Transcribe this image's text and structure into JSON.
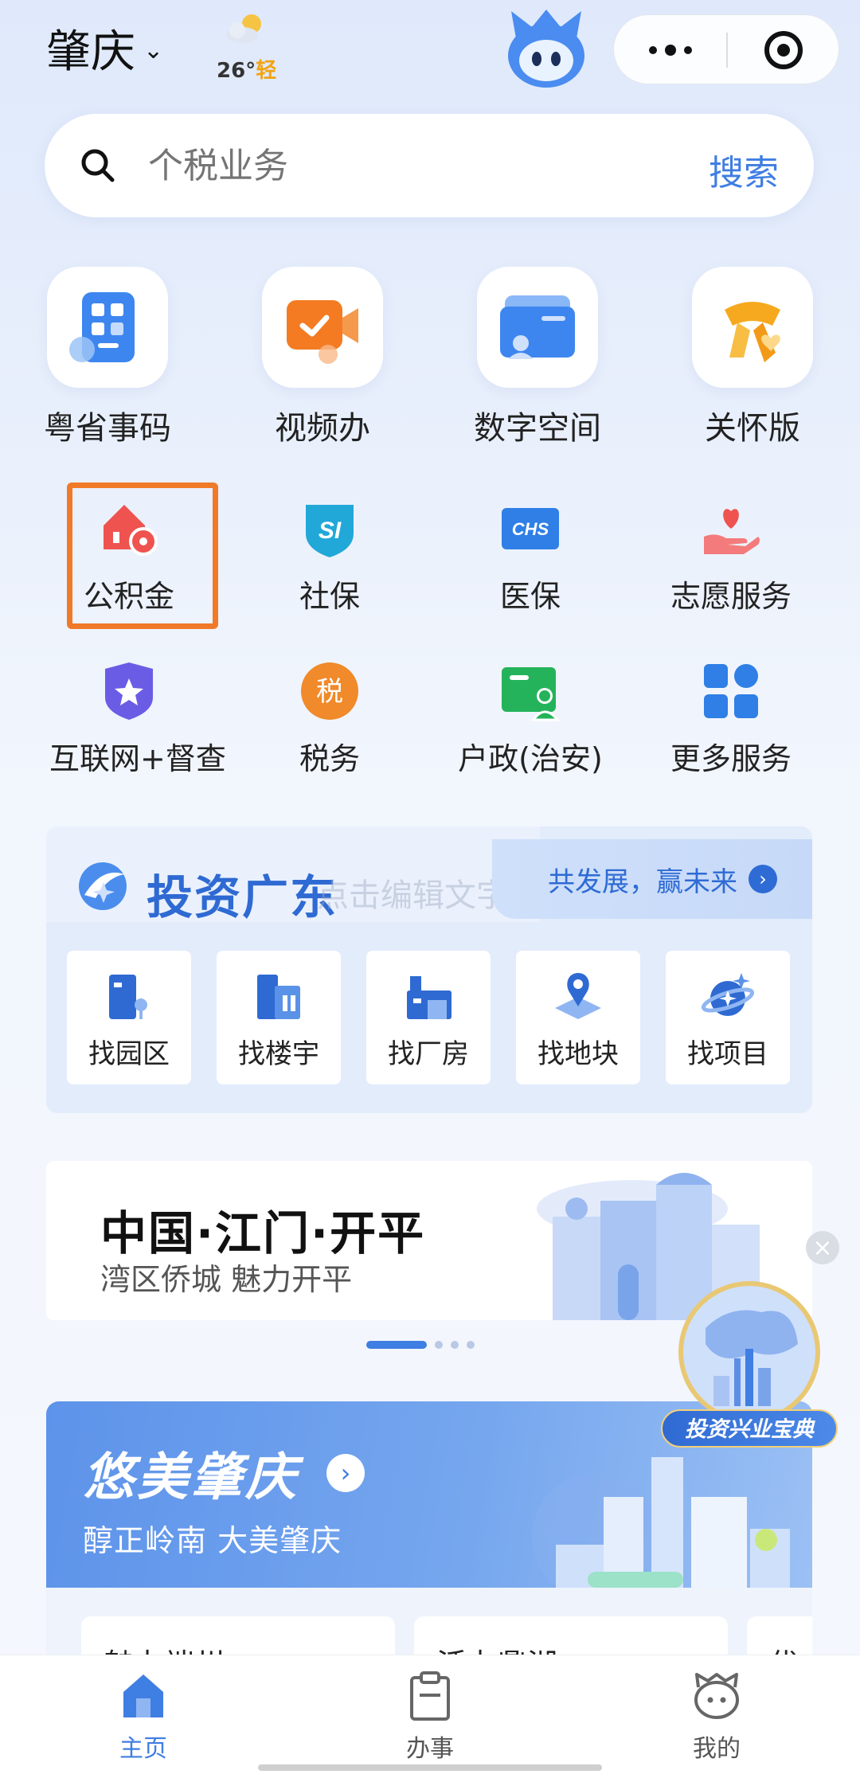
{
  "header": {
    "city": "肇庆",
    "weather_temp": "26°",
    "weather_quality": "轻"
  },
  "search": {
    "placeholder": "个税业务",
    "button": "搜索"
  },
  "quick": [
    {
      "label": "粤省事码",
      "icon": "qr-code-icon"
    },
    {
      "label": "视频办",
      "icon": "video-camera-icon"
    },
    {
      "label": "数字空间",
      "icon": "folder-user-icon"
    },
    {
      "label": "关怀版",
      "icon": "scarf-heart-icon"
    }
  ],
  "services": [
    {
      "label": "公积金",
      "icon": "house-fund-icon"
    },
    {
      "label": "社保",
      "icon": "social-security-icon"
    },
    {
      "label": "医保",
      "icon": "medical-insurance-icon"
    },
    {
      "label": "志愿服务",
      "icon": "heart-hand-icon"
    },
    {
      "label": "互联网+督查",
      "icon": "star-shield-icon"
    },
    {
      "label": "税务",
      "icon": "tax-icon"
    },
    {
      "label": "户政(治安)",
      "icon": "id-card-icon"
    },
    {
      "label": "更多服务",
      "icon": "grid-icon"
    }
  ],
  "service_icon_text": {
    "social": "SI",
    "medical": "CHS",
    "tax": "税"
  },
  "invest": {
    "title": "投资广东",
    "ghost_text": "点击编辑文字",
    "slogan": "共发展，赢未来",
    "items": [
      {
        "label": "找园区",
        "icon": "park-building-icon"
      },
      {
        "label": "找楼宇",
        "icon": "office-building-icon"
      },
      {
        "label": "找厂房",
        "icon": "factory-icon"
      },
      {
        "label": "找地块",
        "icon": "land-pin-icon"
      },
      {
        "label": "找项目",
        "icon": "project-planet-icon"
      }
    ]
  },
  "banner": {
    "title": "中国·江门·开平",
    "subtitle": "湾区侨城 魅力开平"
  },
  "float_badge": {
    "label": "投资兴业宝典"
  },
  "youmei": {
    "title": "悠美肇庆",
    "subtitle": "醇正岭南 大美肇庆",
    "sub_cards": [
      "魅力端州",
      "活力鼎湖",
      "优"
    ]
  },
  "tabs": [
    {
      "label": "主页",
      "icon": "home-icon",
      "active": true
    },
    {
      "label": "办事",
      "icon": "clipboard-icon",
      "active": false
    },
    {
      "label": "我的",
      "icon": "mascot-face-icon",
      "active": false
    }
  ],
  "colors": {
    "accent": "#3f7ee2",
    "highlight_border": "#f07a28",
    "invest_title": "#2f6ad3"
  }
}
